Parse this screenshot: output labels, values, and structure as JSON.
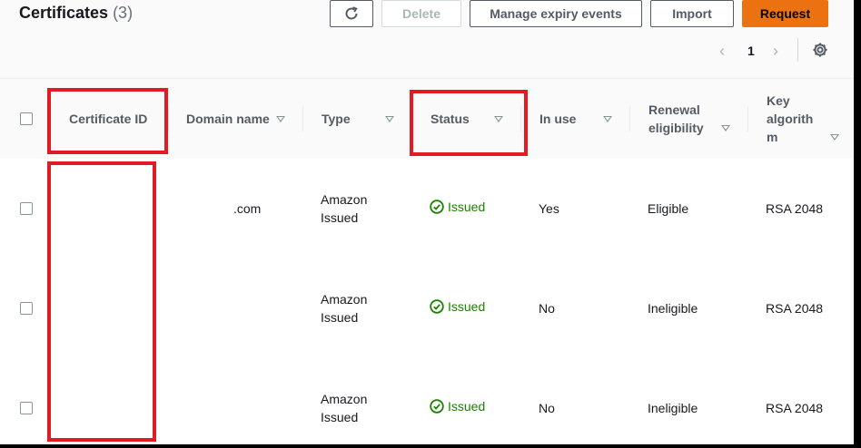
{
  "header": {
    "title": "Certificates",
    "count": "(3)",
    "buttons": {
      "refresh_icon": "refresh-icon",
      "delete": "Delete",
      "manage_expiry": "Manage expiry events",
      "import": "Import",
      "request": "Request"
    },
    "pagination": {
      "prev": "‹",
      "page": "1",
      "next": "›"
    },
    "settings_icon": "gear-icon"
  },
  "columns": {
    "certificate_id": "Certificate ID",
    "domain_name": "Domain name",
    "type": "Type",
    "status": "Status",
    "in_use": "In use",
    "renewal_line1": "Renewal",
    "renewal_line2": "eligibility",
    "key_line1": "Key",
    "key_line2": "algorith",
    "key_line3": "m"
  },
  "rows": [
    {
      "certificate_id": "",
      "domain_name": ".com",
      "type_line1": "Amazon",
      "type_line2": "Issued",
      "status": "Issued",
      "in_use": "Yes",
      "renewal": "Eligible",
      "key_algorithm": "RSA 2048"
    },
    {
      "certificate_id": "",
      "domain_name": "",
      "type_line1": "Amazon",
      "type_line2": "Issued",
      "status": "Issued",
      "in_use": "No",
      "renewal": "Ineligible",
      "key_algorithm": "RSA 2048"
    },
    {
      "certificate_id": "",
      "domain_name": "",
      "type_line1": "Amazon",
      "type_line2": "Issued",
      "status": "Issued",
      "in_use": "No",
      "renewal": "Ineligible",
      "key_algorithm": "RSA 2048"
    }
  ],
  "colors": {
    "accent": "#ec7211",
    "success": "#1d8102",
    "highlight": "#e01b24",
    "text": "#16191f",
    "muted": "#545b64"
  }
}
